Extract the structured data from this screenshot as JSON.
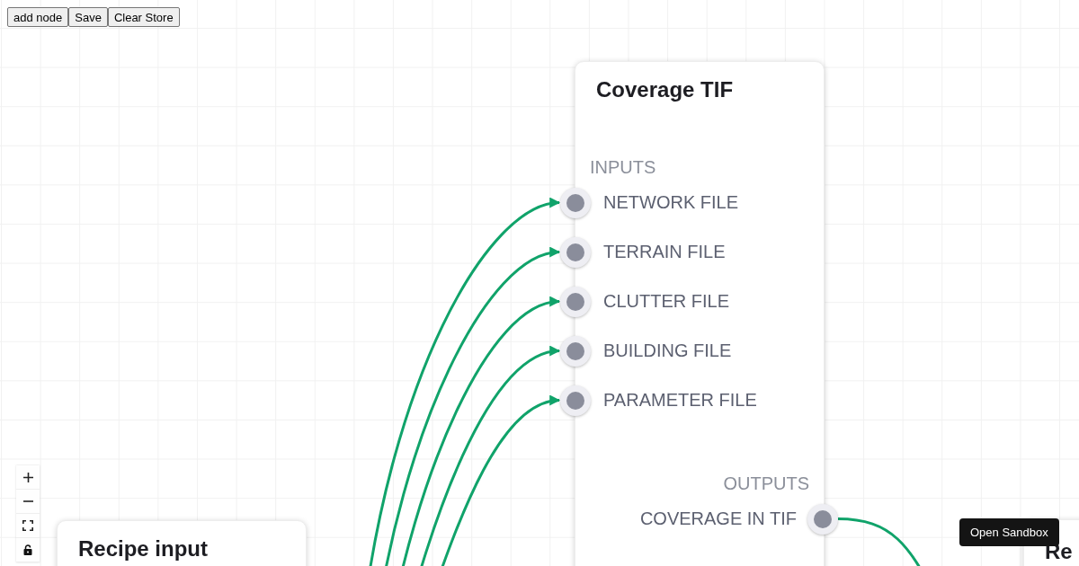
{
  "toolbar": {
    "buttons": [
      "add node",
      "Save",
      "Clear Store"
    ]
  },
  "nodes": [
    {
      "title": "Coverage TIF",
      "inputs_label": "INPUTS",
      "inputs": [
        {
          "label": "NETWORK FILE"
        },
        {
          "label": "TERRAIN FILE"
        },
        {
          "label": "CLUTTER FILE"
        },
        {
          "label": "BUILDING FILE"
        },
        {
          "label": "PARAMETER FILE"
        }
      ],
      "outputs_label": "OUTPUTS",
      "outputs": [
        {
          "label": "COVERAGE IN TIF"
        }
      ]
    },
    {
      "title": "Recipe input"
    },
    {
      "title": "Re"
    }
  ],
  "tooltip": {
    "text": "Open Sandbox"
  }
}
